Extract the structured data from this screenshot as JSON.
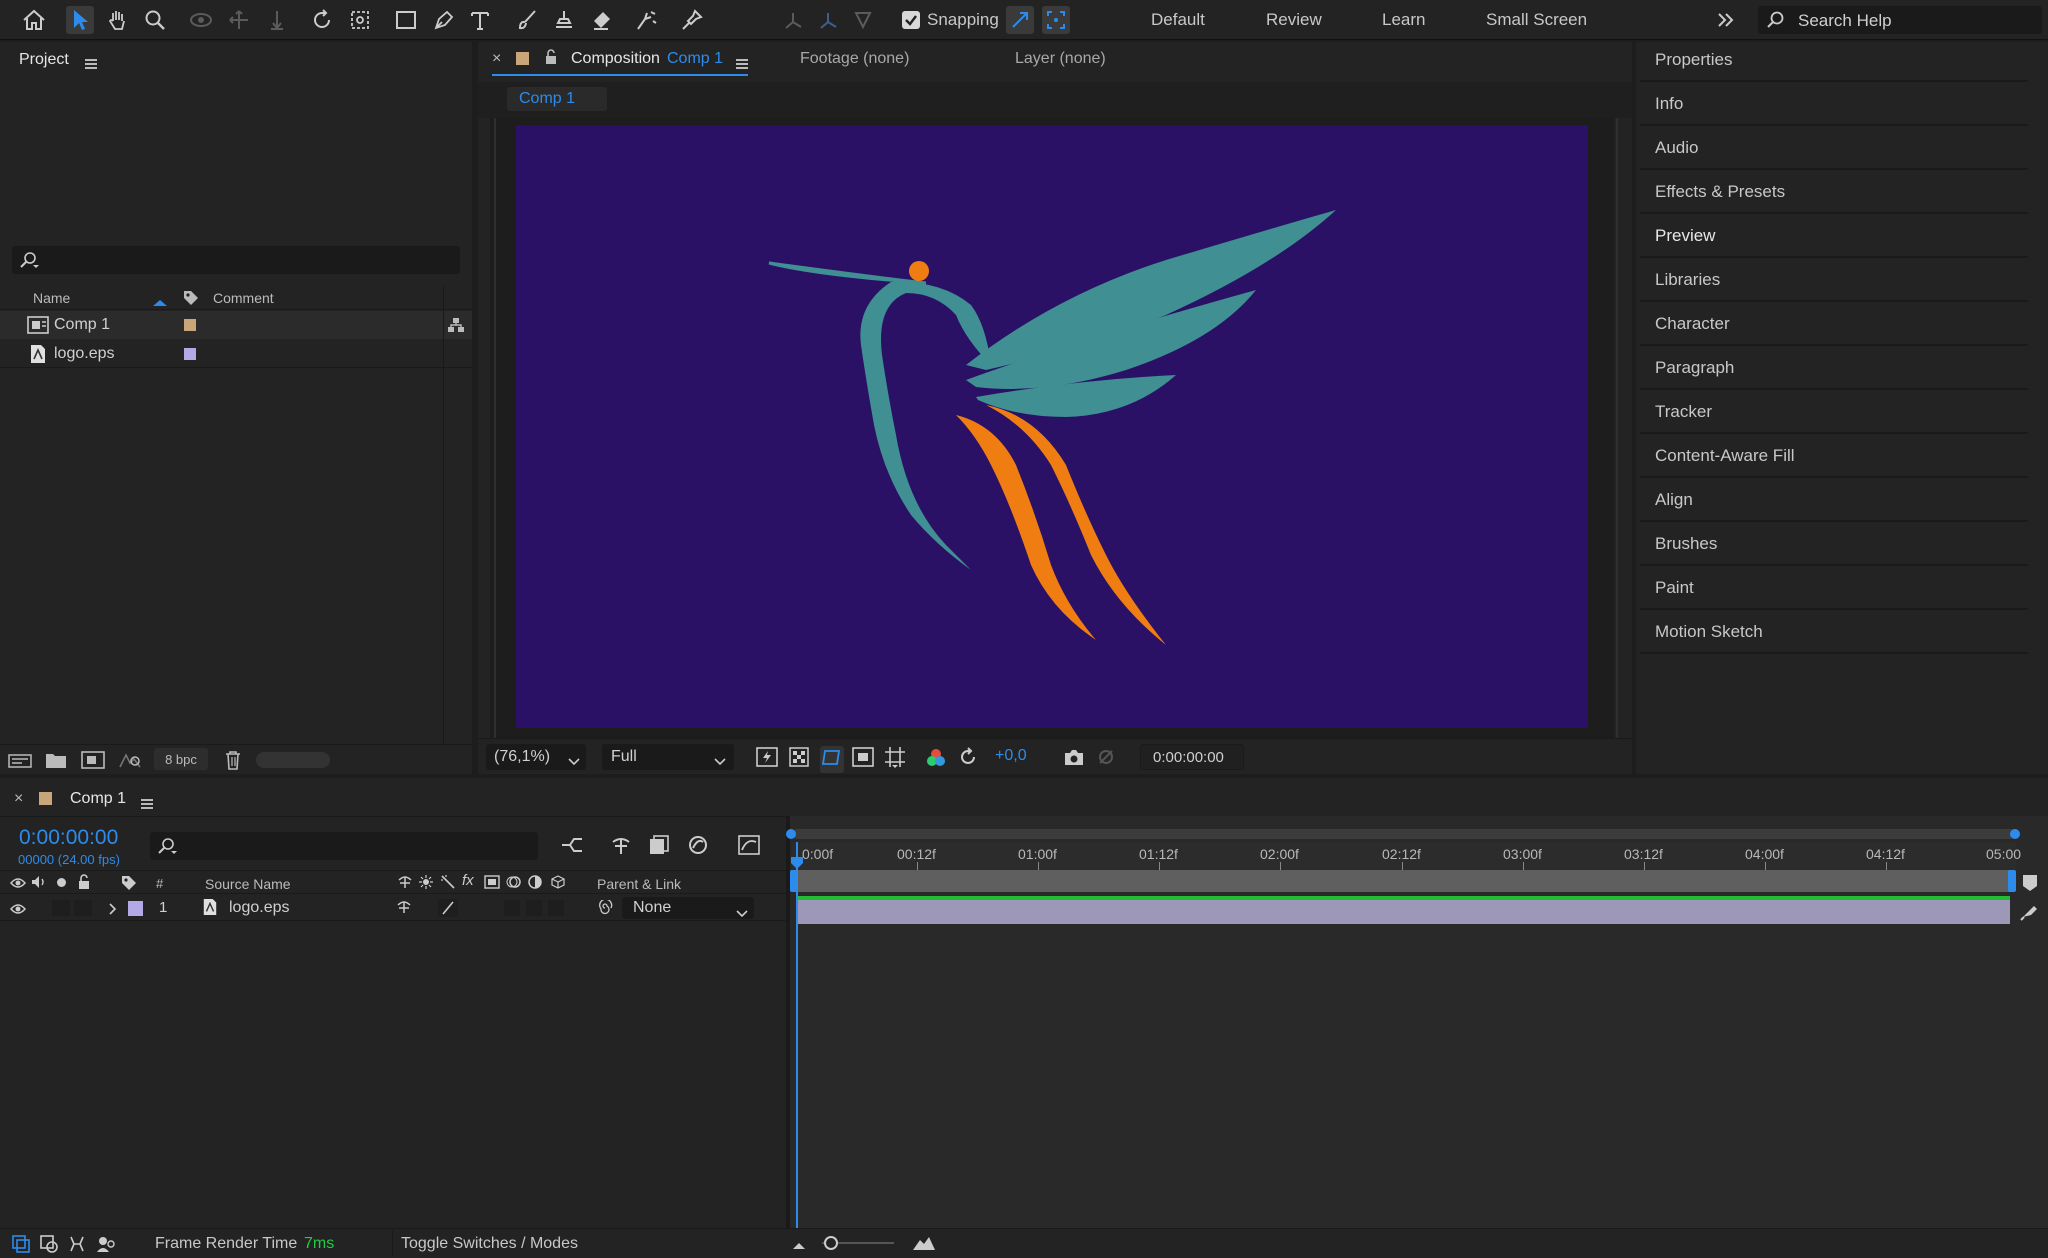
{
  "toolbar": {
    "snapping_label": "Snapping",
    "workspaces": [
      "Default",
      "Review",
      "Learn",
      "Small Screen"
    ],
    "search_placeholder": "Search Help"
  },
  "project": {
    "title": "Project",
    "columns": {
      "name": "Name",
      "comment": "Comment"
    },
    "items": [
      {
        "name": "Comp 1",
        "label_color": "#c8a67a",
        "type": "composition"
      },
      {
        "name": "logo.eps",
        "label_color": "#b3a9e6",
        "type": "eps"
      }
    ],
    "bpc": "8 bpc"
  },
  "composition": {
    "close": "×",
    "title_prefix": "Composition",
    "title_name": "Comp 1",
    "footage_tab": "Footage (none)",
    "layer_tab": "Layer (none)",
    "subtab": "Comp 1",
    "background_color": "#2a1166",
    "zoom": "(76,1%)",
    "resolution": "Full",
    "exposure": "+0,0",
    "timecode": "0:00:00:00"
  },
  "right_panels": [
    "Properties",
    "Info",
    "Audio",
    "Effects & Presets",
    "Preview",
    "Libraries",
    "Character",
    "Paragraph",
    "Tracker",
    "Content-Aware Fill",
    "Align",
    "Brushes",
    "Paint",
    "Motion Sketch"
  ],
  "timeline": {
    "close": "×",
    "comp_name": "Comp 1",
    "timecode": "0:00:00:00",
    "fps": "00000 (24.00 fps)",
    "columns": {
      "num": "#",
      "source": "Source Name",
      "parent": "Parent & Link"
    },
    "layer": {
      "num": "1",
      "name": "logo.eps",
      "parent": "None",
      "label_color": "#b3a9e6"
    },
    "ruler": [
      "0:00f",
      "00:12f",
      "01:00f",
      "01:12f",
      "02:00f",
      "02:12f",
      "03:00f",
      "03:12f",
      "04:00f",
      "04:12f",
      "05:00"
    ]
  },
  "status": {
    "render_label": "Frame Render Time",
    "render_value": "7ms",
    "toggle_label": "Toggle Switches / Modes"
  },
  "colors": {
    "accent": "#2d8ceb",
    "teal": "#3f8f93",
    "orange": "#f07d12",
    "green": "#22bb33"
  }
}
